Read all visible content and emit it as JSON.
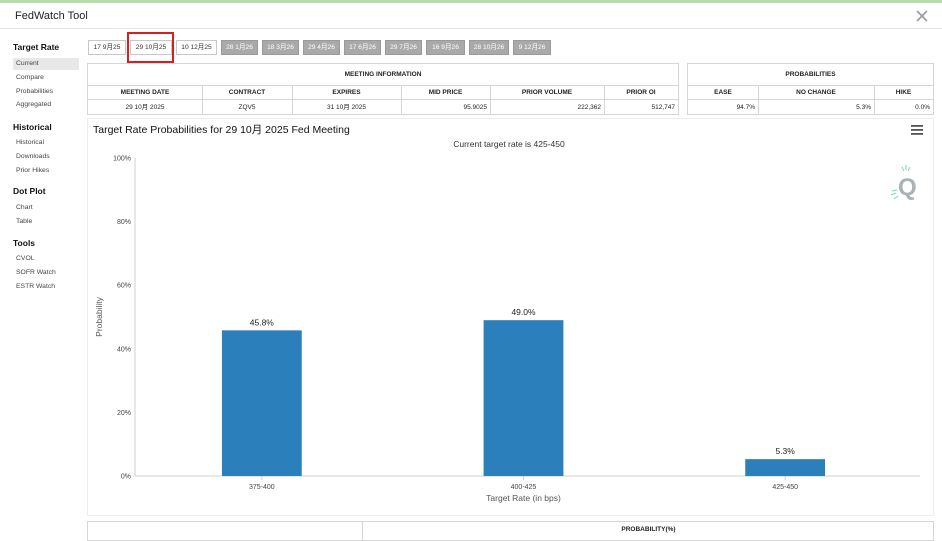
{
  "app": {
    "title": "FedWatch Tool",
    "close_glyph": "X"
  },
  "sidebar": {
    "groups": [
      {
        "title": "Target Rate",
        "items": [
          "Current",
          "Compare",
          "Probabilities",
          "Aggregated"
        ]
      },
      {
        "title": "Historical",
        "items": [
          "Historical",
          "Downloads",
          "Prior Hikes"
        ]
      },
      {
        "title": "Dot Plot",
        "items": [
          "Chart",
          "Table"
        ]
      },
      {
        "title": "Tools",
        "items": [
          "CVOL",
          "SOFR Watch",
          "ESTR Watch"
        ]
      }
    ],
    "active_item": "Current"
  },
  "tabs": [
    "17 9月25",
    "29 10月25",
    "10 12月25",
    "28 1月26",
    "18 3月26",
    "29 4月26",
    "17 6月26",
    "29 7月26",
    "16 9月26",
    "28 10月26",
    "9 12月26"
  ],
  "selected_tab": "29 10月25",
  "meeting_info": {
    "title": "MEETING INFORMATION",
    "headers": [
      "MEETING DATE",
      "CONTRACT",
      "EXPIRES",
      "MID PRICE",
      "PRIOR VOLUME",
      "PRIOR OI"
    ],
    "values": [
      "29 10月 2025",
      "ZQV5",
      "31 10月 2025",
      "95.9025",
      "222,362",
      "512,747"
    ]
  },
  "probabilities": {
    "title": "PROBABILITIES",
    "headers": [
      "EASE",
      "NO CHANGE",
      "HIKE"
    ],
    "values": [
      "94.7%",
      "5.3%",
      "0.0%"
    ]
  },
  "chart": {
    "title": "Target Rate Probabilities for 29 10月 2025 Fed Meeting",
    "subtitle": "Current target rate is 425-450"
  },
  "chart_data": {
    "type": "bar",
    "categories": [
      "375-400",
      "400-425",
      "425-450"
    ],
    "values": [
      45.8,
      49.0,
      5.3
    ],
    "data_labels": [
      "45.8%",
      "49.0%",
      "5.3%"
    ],
    "xlabel": "Target Rate (in bps)",
    "ylabel": "Probability",
    "ylim": [
      0,
      100
    ],
    "yticks": [
      "0%",
      "20%",
      "40%",
      "60%",
      "80%",
      "100%"
    ],
    "bar_color": "#2b7fba",
    "grid": false
  },
  "bottom_table": {
    "header": "PROBABILITY(%)"
  }
}
